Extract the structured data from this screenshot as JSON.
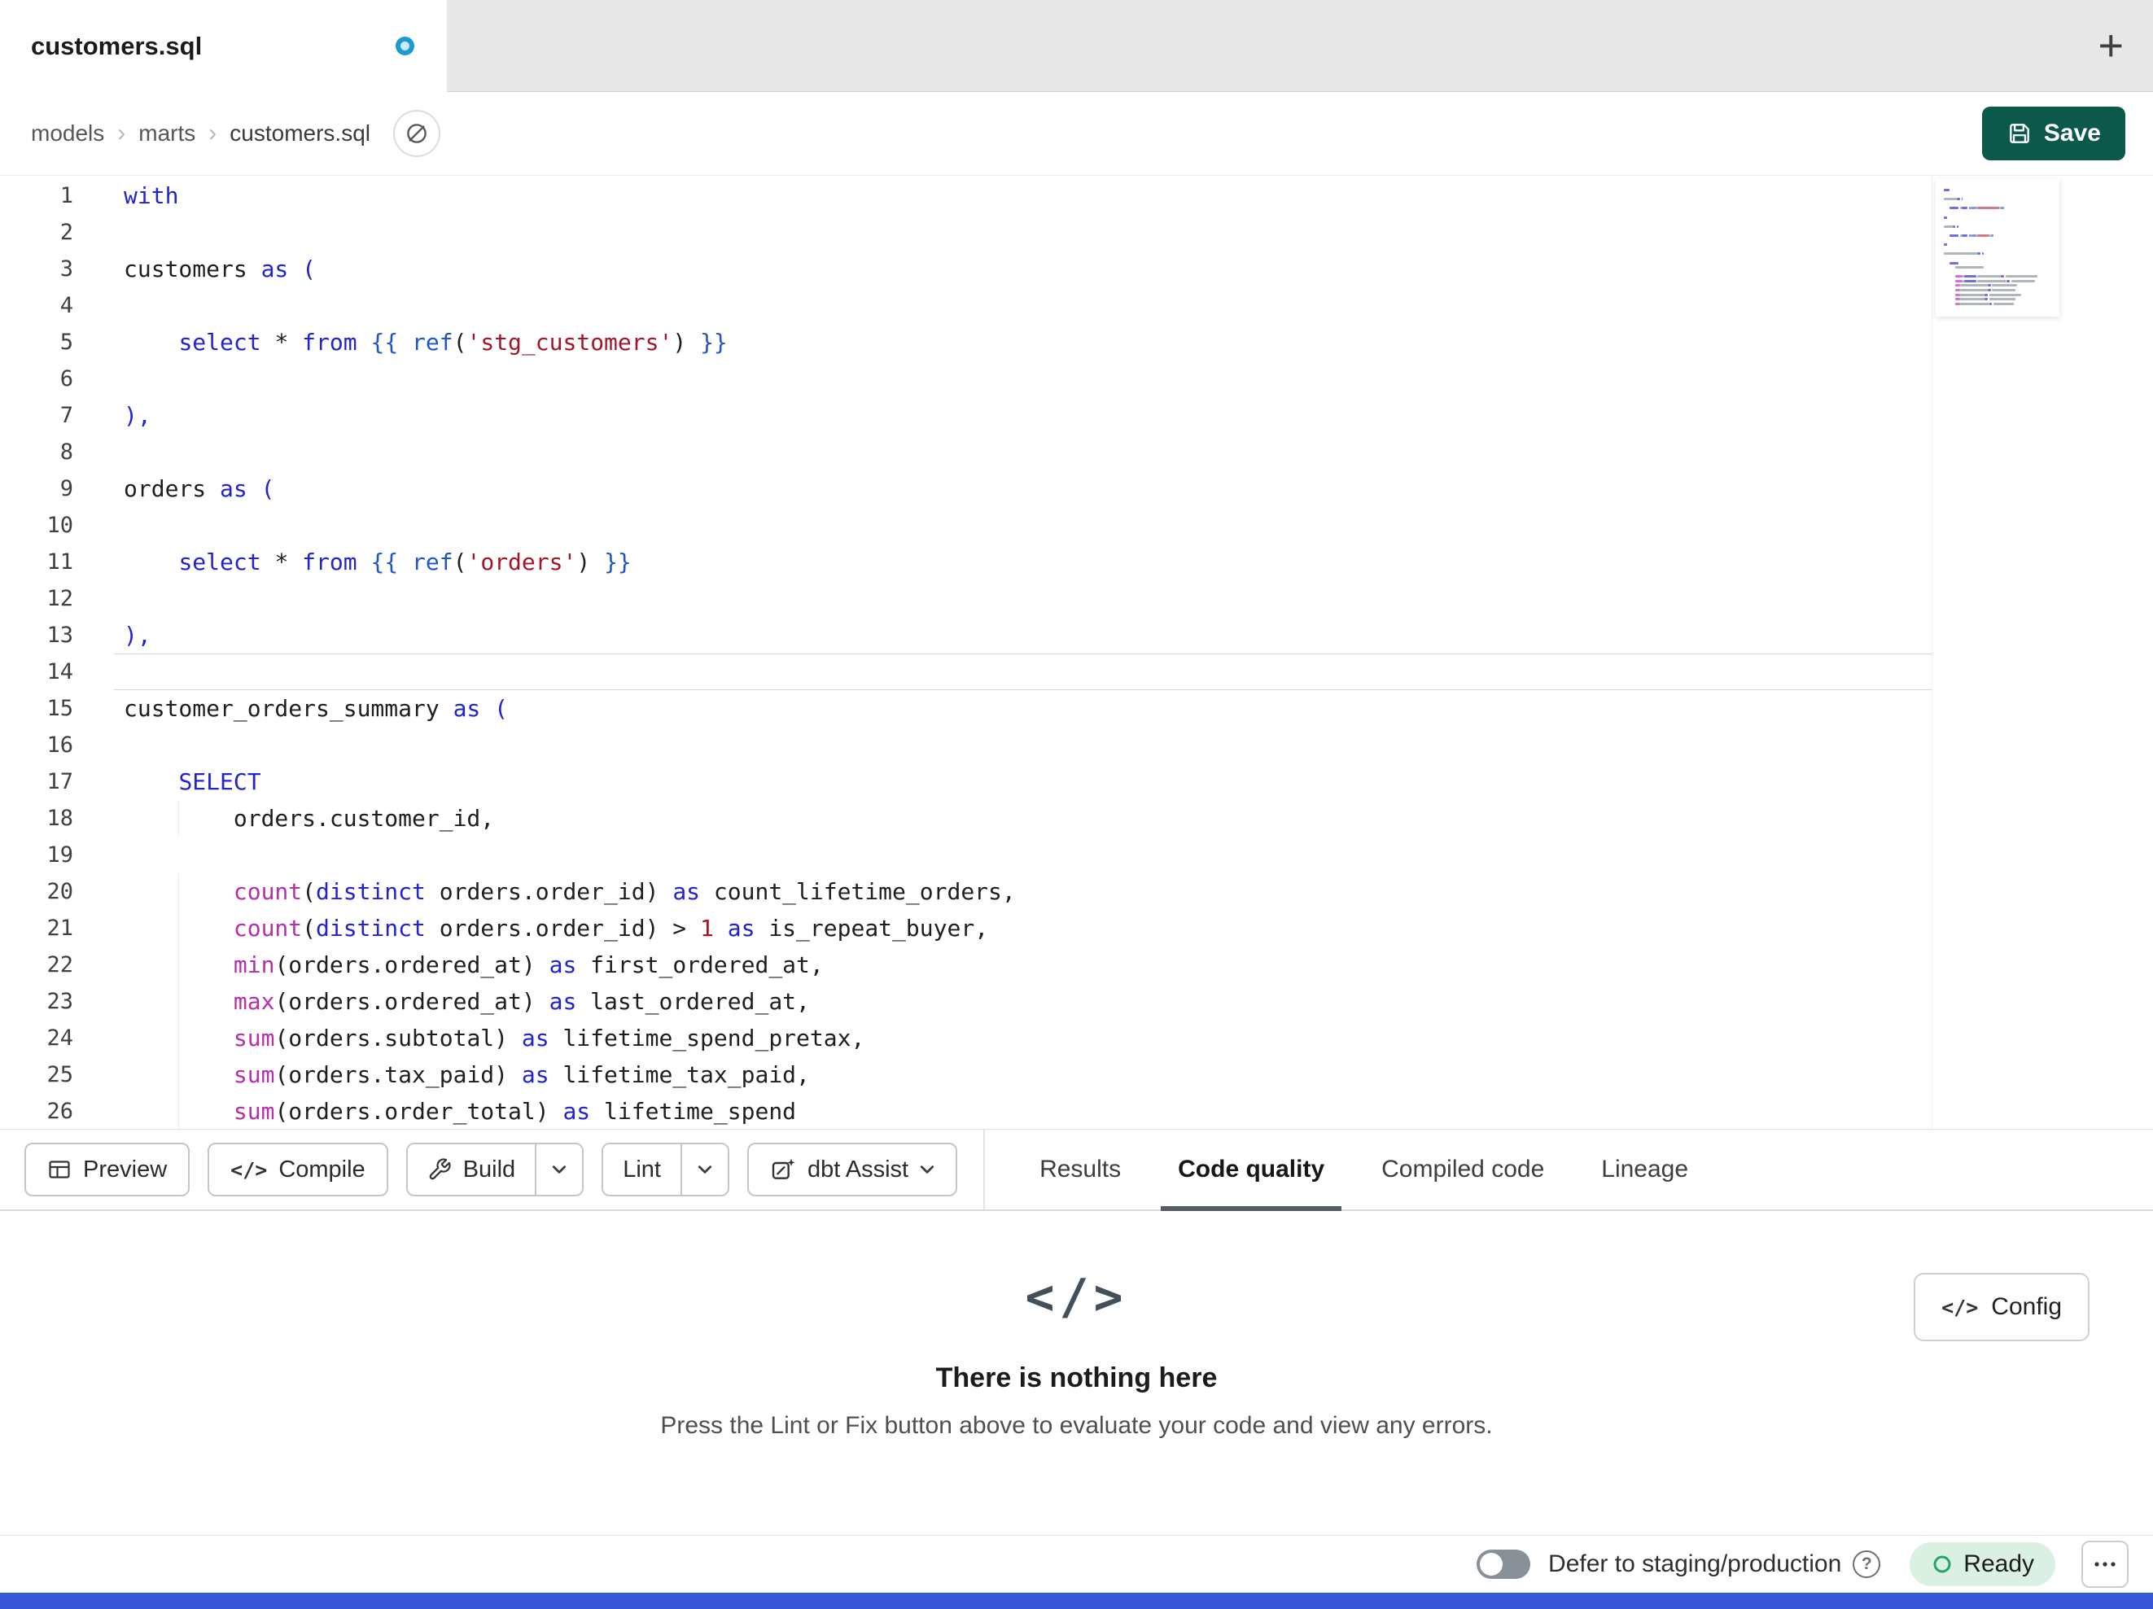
{
  "tab_bar": {
    "active_tab": "customers.sql",
    "modified": true,
    "new_tab_icon": "+"
  },
  "breadcrumb": {
    "items": [
      "models",
      "marts",
      "customers.sql"
    ],
    "separator": "›"
  },
  "save": {
    "label": "Save"
  },
  "icons": {
    "code": "</>"
  },
  "colors": {
    "save_green": "#0c584a",
    "modified_dot_blue": "#1e9ad2",
    "ready_badge_bg": "#d9f0e3",
    "ready_ring_green": "#27a567",
    "bottom_strip_blue": "#3a57d8",
    "keyword_blue": "#2222cf",
    "function_magenta": "#b52fa8",
    "string_red": "#a31529",
    "active_tab_underline": "#565b61"
  },
  "editor": {
    "active_line": 14,
    "lines": [
      {
        "n": 1,
        "tokens": [
          [
            "kw",
            "with"
          ]
        ]
      },
      {
        "n": 2,
        "tokens": []
      },
      {
        "n": 3,
        "tokens": [
          [
            "pl",
            "customers "
          ],
          [
            "kw",
            "as"
          ],
          [
            "pl",
            " "
          ],
          [
            "br",
            "("
          ]
        ]
      },
      {
        "n": 4,
        "tokens": []
      },
      {
        "n": 5,
        "tokens": [
          [
            "pl",
            "    "
          ],
          [
            "kw",
            "select"
          ],
          [
            "pl",
            " * "
          ],
          [
            "kw",
            "from"
          ],
          [
            "pl",
            " "
          ],
          [
            "jj",
            "{{ "
          ],
          [
            "ref",
            "ref"
          ],
          [
            "pl",
            "("
          ],
          [
            "str",
            "'stg_customers'"
          ],
          [
            "pl",
            ") "
          ],
          [
            "jj",
            "}}"
          ]
        ]
      },
      {
        "n": 6,
        "tokens": []
      },
      {
        "n": 7,
        "tokens": [
          [
            "br",
            "),"
          ]
        ]
      },
      {
        "n": 8,
        "tokens": []
      },
      {
        "n": 9,
        "tokens": [
          [
            "pl",
            "orders "
          ],
          [
            "kw",
            "as"
          ],
          [
            "pl",
            " "
          ],
          [
            "br",
            "("
          ]
        ]
      },
      {
        "n": 10,
        "tokens": []
      },
      {
        "n": 11,
        "tokens": [
          [
            "pl",
            "    "
          ],
          [
            "kw",
            "select"
          ],
          [
            "pl",
            " * "
          ],
          [
            "kw",
            "from"
          ],
          [
            "pl",
            " "
          ],
          [
            "jj",
            "{{ "
          ],
          [
            "ref",
            "ref"
          ],
          [
            "pl",
            "("
          ],
          [
            "str",
            "'orders'"
          ],
          [
            "pl",
            ") "
          ],
          [
            "jj",
            "}}"
          ]
        ]
      },
      {
        "n": 12,
        "tokens": []
      },
      {
        "n": 13,
        "tokens": [
          [
            "br",
            "),"
          ]
        ]
      },
      {
        "n": 14,
        "tokens": []
      },
      {
        "n": 15,
        "tokens": [
          [
            "pl",
            "customer_orders_summary "
          ],
          [
            "kw",
            "as"
          ],
          [
            "pl",
            " "
          ],
          [
            "br",
            "("
          ]
        ]
      },
      {
        "n": 16,
        "tokens": []
      },
      {
        "n": 17,
        "tokens": [
          [
            "pl",
            "    "
          ],
          [
            "kw",
            "SELECT"
          ]
        ]
      },
      {
        "n": 18,
        "tokens": [
          [
            "pl",
            "        orders.customer_id,"
          ]
        ]
      },
      {
        "n": 19,
        "tokens": []
      },
      {
        "n": 20,
        "tokens": [
          [
            "pl",
            "        "
          ],
          [
            "fn",
            "count"
          ],
          [
            "pl",
            "("
          ],
          [
            "kw",
            "distinct"
          ],
          [
            "pl",
            " orders.order_id) "
          ],
          [
            "kw",
            "as"
          ],
          [
            "pl",
            " count_lifetime_orders,"
          ]
        ]
      },
      {
        "n": 21,
        "tokens": [
          [
            "pl",
            "        "
          ],
          [
            "fn",
            "count"
          ],
          [
            "pl",
            "("
          ],
          [
            "kw",
            "distinct"
          ],
          [
            "pl",
            " orders.order_id) > "
          ],
          [
            "num",
            "1"
          ],
          [
            "pl",
            " "
          ],
          [
            "kw",
            "as"
          ],
          [
            "pl",
            " is_repeat_buyer,"
          ]
        ]
      },
      {
        "n": 22,
        "tokens": [
          [
            "pl",
            "        "
          ],
          [
            "fn",
            "min"
          ],
          [
            "pl",
            "(orders.ordered_at) "
          ],
          [
            "kw",
            "as"
          ],
          [
            "pl",
            " first_ordered_at,"
          ]
        ]
      },
      {
        "n": 23,
        "tokens": [
          [
            "pl",
            "        "
          ],
          [
            "fn",
            "max"
          ],
          [
            "pl",
            "(orders.ordered_at) "
          ],
          [
            "kw",
            "as"
          ],
          [
            "pl",
            " last_ordered_at,"
          ]
        ]
      },
      {
        "n": 24,
        "tokens": [
          [
            "pl",
            "        "
          ],
          [
            "fn",
            "sum"
          ],
          [
            "pl",
            "(orders.subtotal) "
          ],
          [
            "kw",
            "as"
          ],
          [
            "pl",
            " lifetime_spend_pretax,"
          ]
        ]
      },
      {
        "n": 25,
        "tokens": [
          [
            "pl",
            "        "
          ],
          [
            "fn",
            "sum"
          ],
          [
            "pl",
            "(orders.tax_paid) "
          ],
          [
            "kw",
            "as"
          ],
          [
            "pl",
            " lifetime_tax_paid,"
          ]
        ]
      },
      {
        "n": 26,
        "tokens": [
          [
            "pl",
            "        "
          ],
          [
            "fn",
            "sum"
          ],
          [
            "pl",
            "(orders.order_total) "
          ],
          [
            "kw",
            "as"
          ],
          [
            "pl",
            " lifetime_spend"
          ]
        ]
      }
    ]
  },
  "toolbar": {
    "preview_label": "Preview",
    "compile_label": "Compile",
    "build_label": "Build",
    "lint_label": "Lint",
    "assist_label": "dbt Assist",
    "active_tab": "Code quality",
    "tabs": [
      {
        "label": "Results"
      },
      {
        "label": "Code quality"
      },
      {
        "label": "Compiled code"
      },
      {
        "label": "Lineage"
      }
    ]
  },
  "panel": {
    "config_label": "Config",
    "empty_title": "There is nothing here",
    "empty_subtitle": "Press the Lint or Fix button above to evaluate your code and view any errors."
  },
  "status_bar": {
    "defer_label": "Defer to staging/production",
    "help_icon": "?",
    "ready_label": "Ready"
  }
}
